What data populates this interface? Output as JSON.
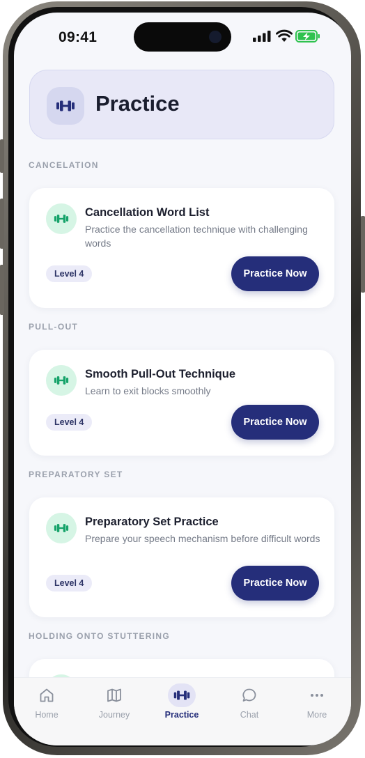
{
  "status": {
    "time": "09:41"
  },
  "header": {
    "title": "Practice",
    "icon": "dumbbell-icon"
  },
  "sections": [
    {
      "label": "CANCELATION",
      "card": {
        "title": "Cancellation Word List",
        "description": "Practice the cancellation technique with challenging words",
        "level": "Level 4",
        "button": "Practice Now"
      }
    },
    {
      "label": "PULL-OUT",
      "card": {
        "title": "Smooth Pull-Out Technique",
        "description": "Learn to exit blocks smoothly",
        "level": "Level 4",
        "button": "Practice Now"
      }
    },
    {
      "label": "PREPARATORY SET",
      "card": {
        "title": "Preparatory Set Practice",
        "description": "Prepare your speech mechanism before difficult words",
        "level": "Level 4",
        "button": "Practice Now"
      }
    },
    {
      "label": "HOLDING ONTO STUTTERING"
    }
  ],
  "tabs": [
    {
      "label": "Home",
      "icon": "home-icon",
      "active": false
    },
    {
      "label": "Journey",
      "icon": "map-icon",
      "active": false
    },
    {
      "label": "Practice",
      "icon": "dumbbell-icon",
      "active": true
    },
    {
      "label": "Chat",
      "icon": "chat-bubble-icon",
      "active": false
    },
    {
      "label": "More",
      "icon": "more-dots-icon",
      "active": false
    }
  ],
  "colors": {
    "accent": "#252e7a",
    "icon_green": "#16a36a",
    "icon_green_bg": "#d6f5e5",
    "header_bg": "#e8e8f7",
    "battery": "#2fc24f"
  }
}
